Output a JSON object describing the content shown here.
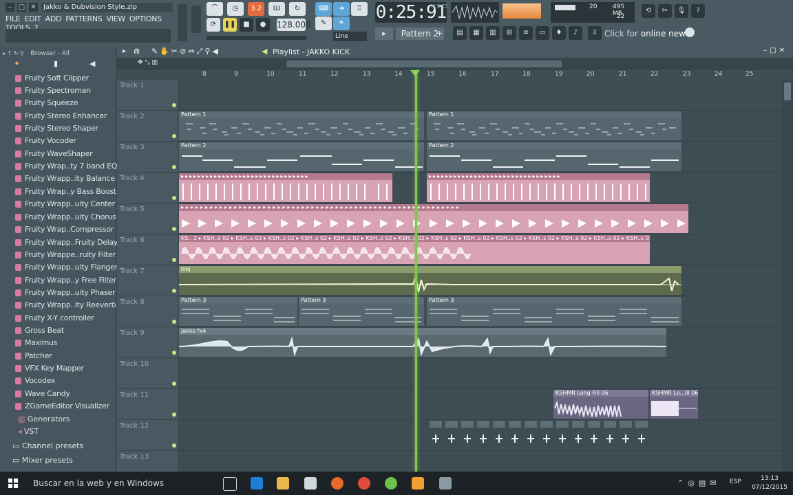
{
  "window": {
    "title": "Jakko & Dubvision Style.zip"
  },
  "menu": [
    "FILE",
    "EDIT",
    "ADD",
    "PATTERNS",
    "VIEW",
    "OPTIONS",
    "TOOLS",
    "?"
  ],
  "transport": {
    "time": "0:25:91",
    "time_unit": "M:S:CS",
    "tempo": "128.000",
    "pattern": "Pattern 2",
    "snap": "Line",
    "meter": "3.2"
  },
  "memory": {
    "cpu_value": "20",
    "mem": "495 MB",
    "poly": "22"
  },
  "news": {
    "prefix": "Click for",
    "label": "online news"
  },
  "browser": {
    "title": "Browser - All",
    "items": [
      "Fruity Soft Clipper",
      "Fruity Spectroman",
      "Fruity Squeeze",
      "Fruity Stereo Enhancer",
      "Fruity Stereo Shaper",
      "Fruity Vocoder",
      "Fruity WaveShaper",
      "Fruity Wrap..ty 7 band EQ",
      "Fruity Wrapp..ity Balance",
      "Fruity Wrap..y Bass Boost",
      "Fruity Wrapp..uity Center",
      "Fruity Wrapp..uity Chorus",
      "Fruity Wrap..Compressor",
      "Fruity Wrapp..Fruity Delay",
      "Fruity Wrappe..ruity Filter",
      "Fruity Wrapp..uity Flanger",
      "Fruity Wrapp..y Free Filter",
      "Fruity Wrapp..uity Phaser",
      "Fruity Wrapp..ity Reeverb",
      "Fruity X-Y controller",
      "Gross Beat",
      "Maximus",
      "Patcher",
      "VFX Key Mapper",
      "Vocodex",
      "Wave Candy",
      "ZGameEditor Visualizer"
    ],
    "folders": [
      "Generators",
      "VST",
      "Channel presets",
      "Mixer presets"
    ]
  },
  "playlist": {
    "title": "Playlist - JAKKO KICK",
    "ruler": [
      "8",
      "9",
      "10",
      "11",
      "12",
      "13",
      "14",
      "15",
      "16",
      "17",
      "18",
      "19",
      "20",
      "21",
      "22",
      "23",
      "24",
      "25"
    ],
    "tracks": [
      "Track 1",
      "Track 2",
      "Track 3",
      "Track 4",
      "Track 5",
      "Track 6",
      "Track 7",
      "Track 8",
      "Track 9",
      "Track 10",
      "Track 11",
      "Track 12",
      "Track 13"
    ],
    "clip_labels": {
      "t2a": "Pattern 1",
      "t2b": "Pattern 1",
      "t3a": "Pattern 2",
      "t3b": "Pattern 2",
      "t6": "KS.. 2 ▸ KSH..s 02 ▸ KSH..s 02 ▸ KSH..s 02 ▸ KSH..s 02 ▸ KSH..s 02 ▸ KSH..s 02 ▸ KSH..s 02 ▸ KSH..s 02 ▸ KSH..s 02 ▸ KSH..s 02 ▸ KSH..s 02 ▸ KSH..s 02 ▸ KSH..s 02 ▸ KSH..s 02",
      "t7": "kikj",
      "t8a": "Pattern 3",
      "t8b": "Pattern 3",
      "t8c": "Pattern 3",
      "t9": "Jakko fx4",
      "t11a": "KSHMR Long Fill 06",
      "t11b": "KSHMR Lo...ill 06"
    }
  },
  "taskbar": {
    "search": "Buscar en la web y en Windows",
    "lang": "ESP",
    "time": "13:13",
    "date": "07/12/2015"
  }
}
